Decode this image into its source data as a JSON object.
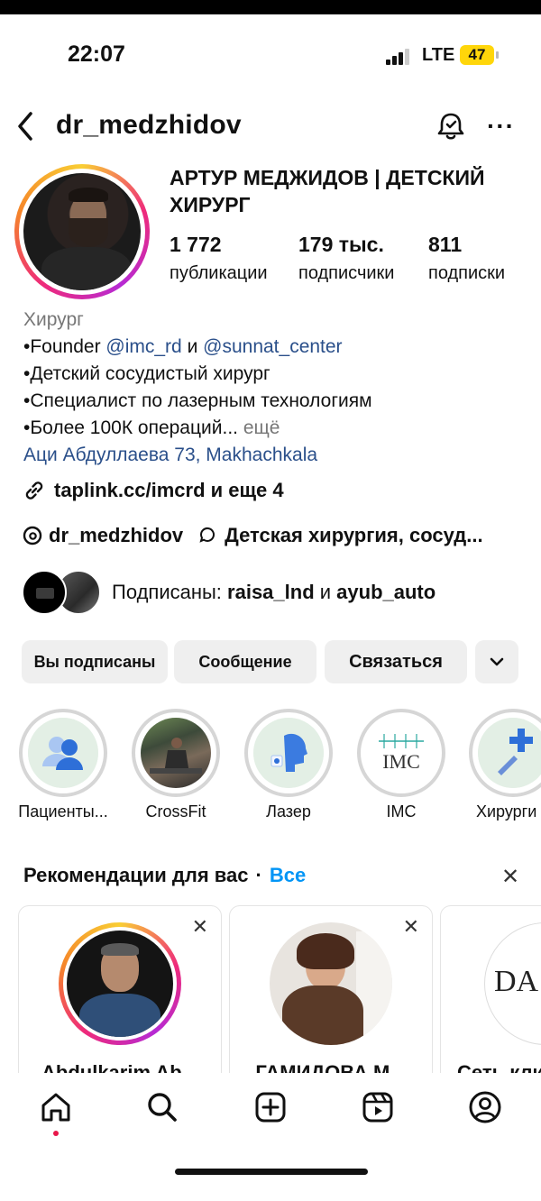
{
  "status": {
    "time": "22:07",
    "network": "LTE",
    "battery": "47"
  },
  "header": {
    "username": "dr_medzhidov"
  },
  "profile": {
    "display_name": "АРТУР МЕДЖИДОВ | ДЕТСКИЙ ХИРУРГ",
    "stats": [
      {
        "value": "1 772",
        "label": "публикации"
      },
      {
        "value": "179 тыс.",
        "label": "подписчики"
      },
      {
        "value": "811",
        "label": "подписки"
      }
    ],
    "category": "Хирург",
    "bio": {
      "line1_prefix": "•Founder ",
      "mention1": "@imc_rd",
      "line1_mid": " и ",
      "mention2": "@sunnat_center",
      "line2": "•Детский сосудистый хирург",
      "line3": "•Специалист по лазерным технологиям",
      "line4": "•Более 100К операций...",
      "more": " ещё",
      "address": "Аци Абдуллаева 73, Makhachkala"
    },
    "link": "taplink.cc/imcrd и еще 4",
    "threads_handle": "dr_medzhidov",
    "topic": "Детская хирургия, сосуд..."
  },
  "followed_by": {
    "prefix": "Подписаны: ",
    "user1": "raisa_lnd",
    "and": " и ",
    "user2": "ayub_auto"
  },
  "buttons": {
    "following": "Вы подписаны",
    "message": "Сообщение",
    "contact": "Связаться"
  },
  "highlights": [
    {
      "label": "Пациенты..."
    },
    {
      "label": "CrossFit"
    },
    {
      "label": "Лазер"
    },
    {
      "label": "IMC",
      "logo_text": "IMC"
    },
    {
      "label": "Хирурги"
    }
  ],
  "recommendations": {
    "title": "Рекомендации для вас",
    "dot": "·",
    "all": "Все",
    "cards": [
      {
        "name": "Abdulkarim Ab..."
      },
      {
        "name": "ГАМИДОВА М..."
      },
      {
        "name": "Сеть кли...",
        "logo_text": "DA"
      }
    ]
  },
  "colors": {
    "link": "#2a4f8a",
    "accent": "#0095f6",
    "battery": "#ffd60a",
    "notification_dot": "#e8174a"
  },
  "tabbar": [
    "home-icon",
    "search-icon",
    "create-icon",
    "reels-icon",
    "profile-icon"
  ]
}
